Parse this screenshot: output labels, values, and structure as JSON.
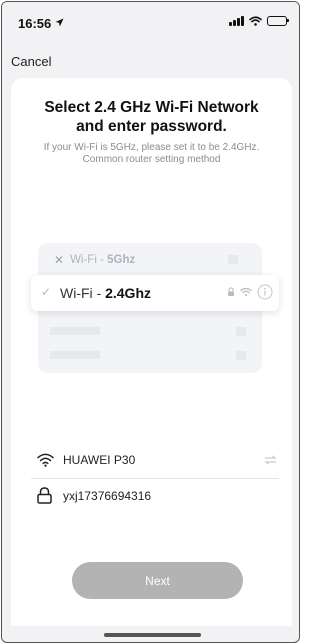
{
  "status_bar": {
    "time": "16:56"
  },
  "nav": {
    "cancel_label": "Cancel"
  },
  "main": {
    "title": "Select 2.4 GHz Wi-Fi Network and enter password.",
    "subtitle": "If your Wi-Fi is 5GHz, please set it to be 2.4GHz. Common router setting method"
  },
  "illustration": {
    "row_5g": {
      "prefix": "Wi-Fi - ",
      "band": "5Ghz"
    },
    "row_24": {
      "prefix": "Wi-Fi - ",
      "band": "2.4Ghz"
    }
  },
  "form": {
    "ssid_value": "HUAWEI P30",
    "password_value": "yxj17376694316"
  },
  "actions": {
    "next_label": "Next"
  },
  "colors": {
    "button_disabled": "#b3b3b3",
    "background": "#f2f2f4",
    "card": "#ffffff"
  }
}
